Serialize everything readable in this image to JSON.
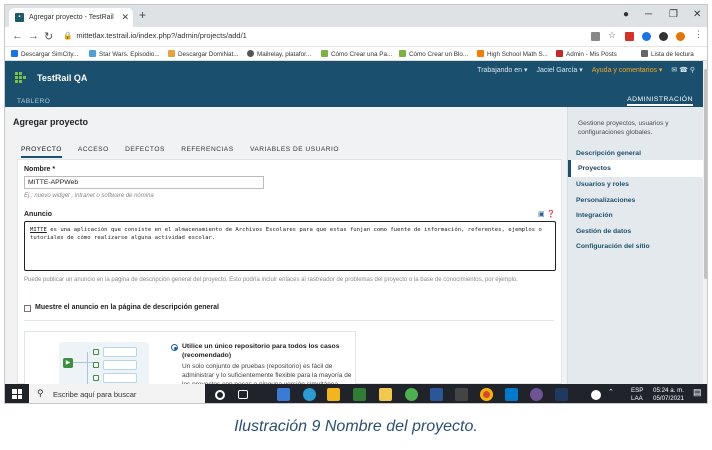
{
  "browser": {
    "tab_title": "Agregar proyecto - TestRail",
    "url": "mittetlax.testrail.io/index.php?/admin/projects/add/1",
    "bookmarks": [
      "Descargar SimCity...",
      "Star Wars. Episodio...",
      "Descargar DomiNat...",
      "Mailrelay, platafor...",
      "Cómo Crear una Pa...",
      "Cómo Crear un Blo...",
      "High School Math S...",
      "Admin - Mis Posts",
      "Lista de lectura"
    ]
  },
  "header": {
    "brand": "TestRail QA",
    "nav": [
      "Trabajando en ▾",
      "Jaciel García ▾",
      "Ayuda y comentarios ▾"
    ],
    "left_link": "TABLERO",
    "right_link": "ADMINISTRACIÓN"
  },
  "page": {
    "title": "Agregar proyecto",
    "tabs": [
      "PROYECTO",
      "ACCESO",
      "DEFECTOS",
      "REFERENCIAS",
      "VARIABLES DE USUARIO"
    ],
    "name_label": "Nombre",
    "name_required": "*",
    "name_value": "MITTE-APPWeb",
    "name_hint": "Ej.: nuevo widget , intranet o software de nómina",
    "announce_label": "Anuncio",
    "announce_first_word": "MITTE",
    "announce_rest": " es una aplicación que consiste en el almacenamiento de Archivos Escolares para que estas funjan como fuente de información, referentes, ejemplos o tutoriales de cómo realizarse alguna actividad escolar.",
    "announce_help": "Puede publicar un anuncio en la página de descripción general del proyecto. Esto podría incluir enlaces al rastreador de problemas del proyecto o la base de conocimientos, por ejemplo.",
    "show_announce_label": "Muestre el anuncio en la página de descripción general",
    "repo_option_title": "Utilice un único repositorio para todos los casos (recomendado)",
    "repo_option_desc": "Un solo conjunto de pruebas (repositorio) es fácil de administrar y lo suficientemente flexible para la mayoría de los proyectos con pocas o ninguna versión simultánea."
  },
  "sidebar": {
    "description": "Gestione proyectos, usuarios y configuraciones globales.",
    "items": [
      "Descripción general",
      "Proyectos",
      "Usuarios y roles",
      "Personalizaciones",
      "Integración",
      "Gestión de datos",
      "Configuración del sitio"
    ],
    "active_index": 1
  },
  "taskbar": {
    "search_placeholder": "Escribe aquí para buscar",
    "lang_top": "ESP",
    "lang_bottom": "LAA",
    "time": "05:24 a. m.",
    "date": "05/07/2021"
  },
  "caption": "Ilustración 9 Nombre del proyecto.",
  "colors": {
    "header_bg": "#1b4f6e",
    "accent_green": "#7cc143",
    "help_orange": "#f6a623",
    "taskbar_bg": "#20232a"
  }
}
